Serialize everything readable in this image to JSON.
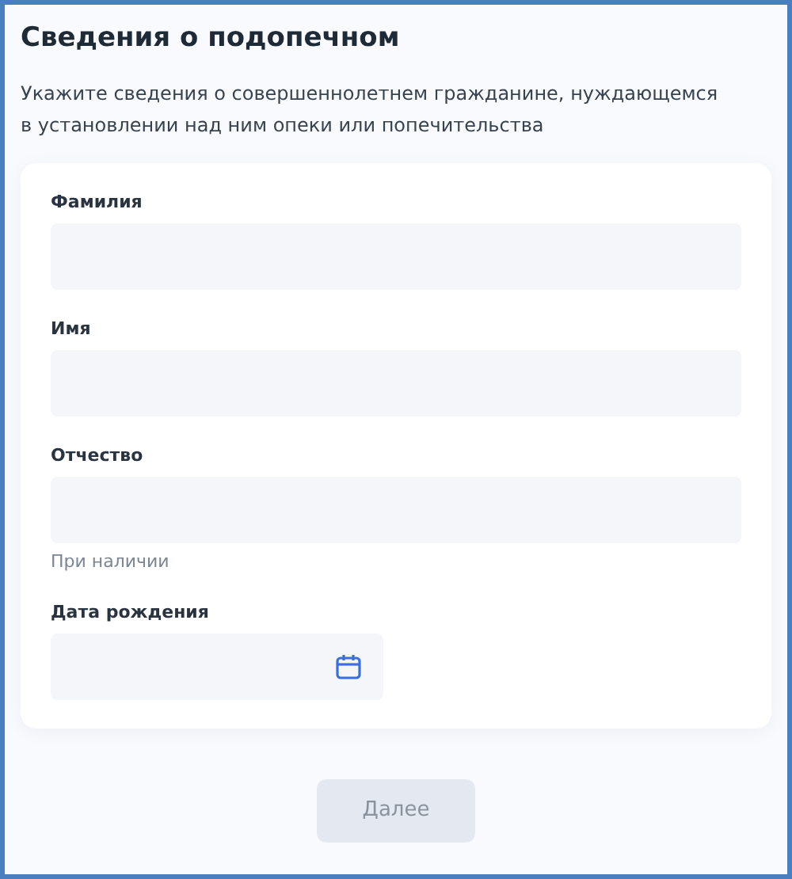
{
  "title": "Сведения о подопечном",
  "description": "Укажите сведения о совершеннолетнем гражданине, нуждающемся в установлении над ним опеки или попечительства",
  "fields": [
    {
      "kind": "text",
      "label": "Фамилия"
    },
    {
      "kind": "text",
      "label": "Имя"
    },
    {
      "kind": "text",
      "label": "Отчество",
      "hint": "При наличии"
    },
    {
      "kind": "date",
      "label": "Дата рождения"
    }
  ],
  "next_button": {
    "label": "Далее",
    "disabled": true
  }
}
